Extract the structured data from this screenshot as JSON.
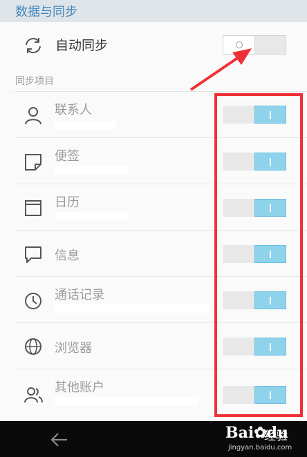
{
  "header": {
    "title": "数据与同步"
  },
  "auto_sync": {
    "label": "自动同步",
    "enabled": false
  },
  "section": {
    "title": "同步项目"
  },
  "items": [
    {
      "label": "联系人",
      "icon": "person-icon",
      "enabled": true
    },
    {
      "label": "便签",
      "icon": "note-icon",
      "enabled": true
    },
    {
      "label": "日历",
      "icon": "calendar-icon",
      "enabled": true
    },
    {
      "label": "信息",
      "icon": "message-icon",
      "enabled": true
    },
    {
      "label": "通话记录",
      "icon": "clock-icon",
      "enabled": true
    },
    {
      "label": "浏览器",
      "icon": "globe-icon",
      "enabled": true
    },
    {
      "label": "其他账户",
      "icon": "accounts-icon",
      "enabled": true
    }
  ],
  "watermark": {
    "brand_left": "Bai",
    "brand_mid": "du",
    "brand_right": "经验",
    "url": "jingyan.baidu.com"
  },
  "colors": {
    "accent": "#3e86c0",
    "toggle_on": "#8fd2ec",
    "annotation": "#ef3137"
  }
}
